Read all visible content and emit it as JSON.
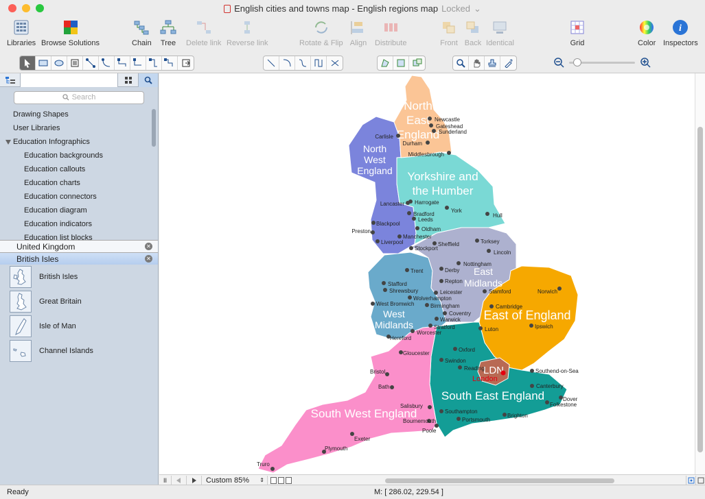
{
  "window": {
    "title": "English cities and towns map - English regions map",
    "locked": "Locked",
    "traffic_colors": [
      "#fc5f57",
      "#fdbc2e",
      "#29c840"
    ]
  },
  "toolbar": {
    "libraries": "Libraries",
    "browse_solutions": "Browse Solutions",
    "chain": "Chain",
    "tree": "Tree",
    "delete_link": "Delete link",
    "reverse_link": "Reverse link",
    "rotate_flip": "Rotate & Flip",
    "align": "Align",
    "distribute": "Distribute",
    "front": "Front",
    "back": "Back",
    "identical": "Identical",
    "grid": "Grid",
    "color": "Color",
    "inspectors": "Inspectors"
  },
  "sidebar": {
    "search_placeholder": "Search",
    "libraries": [
      {
        "label": "Drawing Shapes"
      },
      {
        "label": "User Libraries"
      }
    ],
    "group": "Education Infographics",
    "group_items": [
      {
        "label": "Education backgrounds"
      },
      {
        "label": "Education callouts"
      },
      {
        "label": "Education charts"
      },
      {
        "label": "Education connectors"
      },
      {
        "label": "Education diagram"
      },
      {
        "label": "Education indicators"
      },
      {
        "label": "Education list blocks"
      }
    ],
    "trays": [
      "United Kingdom",
      "British Isles"
    ],
    "shapes": [
      {
        "label": "British Isles"
      },
      {
        "label": "Great Britain"
      },
      {
        "label": "Isle of Man"
      },
      {
        "label": "Channel Islands"
      }
    ]
  },
  "map": {
    "region_colors": {
      "north_east": "#fbc596",
      "north_west": "#7b84dc",
      "yorkshire": "#7ad9d5",
      "east_midlands": "#adb1cf",
      "west_midlands": "#6aaacb",
      "east": "#f6a800",
      "london": "#b86a54",
      "south_east": "#139d96",
      "south_west": "#fb8fca"
    },
    "regions": {
      "north_east": [
        "North",
        "East",
        "England"
      ],
      "north_west": [
        "North",
        "West",
        "England"
      ],
      "yorkshire": [
        "Yorkshire and",
        "the Humber"
      ],
      "east_midlands": [
        "East",
        "Midlands"
      ],
      "west_midlands": [
        "West",
        "Midlands"
      ],
      "east": "East of England",
      "london": "LDN",
      "south_east": "South East England",
      "south_west": "South West England"
    },
    "cities": [
      "Newcastle",
      "Gateshead",
      "Sunderland",
      "Carlisle",
      "Durham",
      "Middlesbrough",
      "Lancaster",
      "Harrogate",
      "York",
      "Bradford",
      "Leeds",
      "Hull",
      "Blackpool",
      "Oldham",
      "Preston",
      "Manchester",
      "Liverpool",
      "Sheffield",
      "Stockport",
      "Torksey",
      "Lincoln",
      "Nottingham",
      "Trent",
      "Derby",
      "Repton",
      "Stafford",
      "Shrewsbury",
      "Leicester",
      "Stamford",
      "Wolverhampton",
      "Norwich",
      "West Bromwich",
      "Birmingham",
      "Cambridge",
      "Coventry",
      "Warwick",
      "Stratford",
      "Ipswich",
      "Luton",
      "Worcester",
      "Hereford",
      "Gloucester",
      "Oxford",
      "Swindon",
      "Reading",
      "London",
      "Southend-on-Sea",
      "Bristol",
      "Bath",
      "Canterbury",
      "Dover",
      "Folkestone",
      "Salisbury",
      "Southampton",
      "Portsmouth",
      "Bournemouth",
      "Brighton",
      "Poole",
      "Exeter",
      "Plymouth",
      "Truro"
    ]
  },
  "bottom": {
    "zoom": "Custom 85%"
  },
  "status": {
    "ready": "Ready",
    "mouse": "M: [ 286.02, 229.54 ]"
  }
}
